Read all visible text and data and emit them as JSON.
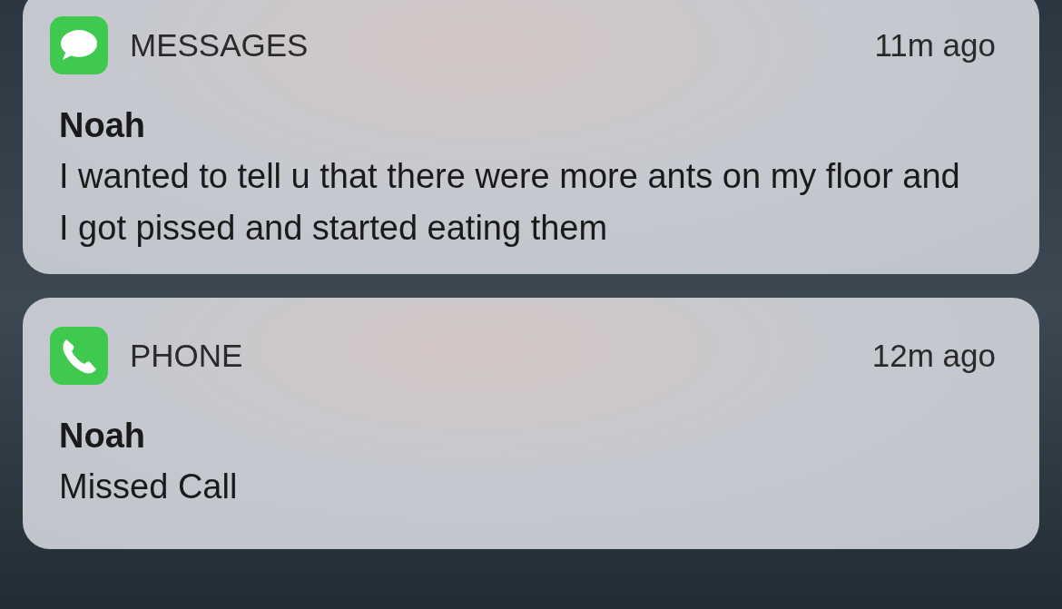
{
  "notifications": [
    {
      "kind": "messages",
      "app": "MESSAGES",
      "time": "11m ago",
      "sender": "Noah",
      "body": "I wanted to tell u that there were more ants on my floor and I got pissed and started eating them"
    },
    {
      "kind": "phone",
      "app": "PHONE",
      "time": "12m ago",
      "sender": "Noah",
      "body": "Missed Call"
    }
  ]
}
